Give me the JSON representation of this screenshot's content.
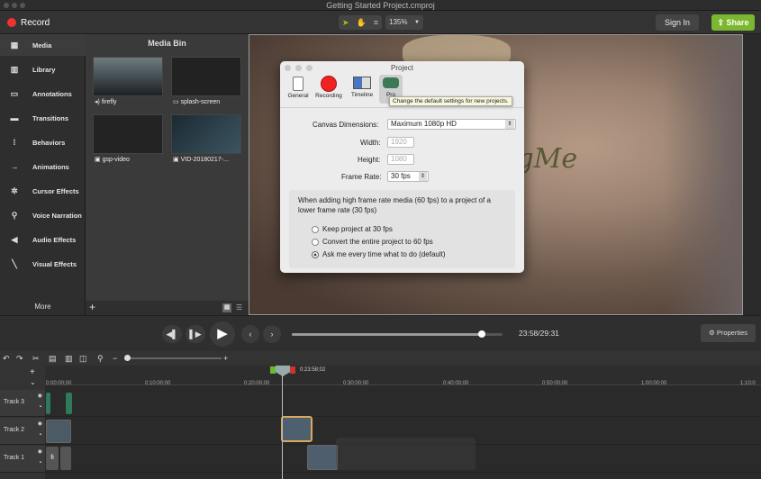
{
  "window": {
    "title": "Getting Started Project.cmproj"
  },
  "toolbar": {
    "record_label": "Record",
    "zoom": "135%",
    "sign_in": "Sign In",
    "share": "Share"
  },
  "sidebar": {
    "items": [
      {
        "label": "Media",
        "icon": "film-icon"
      },
      {
        "label": "Library",
        "icon": "library-icon"
      },
      {
        "label": "Annotations",
        "icon": "annotation-icon"
      },
      {
        "label": "Transitions",
        "icon": "transition-icon"
      },
      {
        "label": "Behaviors",
        "icon": "behavior-icon"
      },
      {
        "label": "Animations",
        "icon": "animation-icon"
      },
      {
        "label": "Cursor Effects",
        "icon": "cursor-icon"
      },
      {
        "label": "Voice Narration",
        "icon": "microphone-icon"
      },
      {
        "label": "Audio Effects",
        "icon": "speaker-icon"
      },
      {
        "label": "Visual Effects",
        "icon": "wand-icon"
      }
    ],
    "more": "More"
  },
  "media_bin": {
    "title": "Media Bin",
    "items": [
      {
        "label": "firefly"
      },
      {
        "label": "splash-screen"
      },
      {
        "label": "gsp-video"
      },
      {
        "label": "VID-20180217-..."
      }
    ],
    "add": "+"
  },
  "dialog": {
    "title": "Project",
    "tabs": [
      "General",
      "Recording",
      "Timeline",
      "Pro"
    ],
    "tooltip": "Change the default settings for new projects.",
    "canvas_label": "Canvas Dimensions:",
    "canvas_value": "Maximum 1080p HD",
    "width_label": "Width:",
    "width_value": "1920",
    "height_label": "Height:",
    "height_value": "1080",
    "framerate_label": "Frame Rate:",
    "framerate_value": "30 fps",
    "note": "When adding high frame rate media (60 fps) to a project of a lower frame rate (30 fps)",
    "options": [
      "Keep project at 30 fps",
      "Convert the entire project to 60 fps",
      "Ask me every time what to do (default)"
    ],
    "selected_option": 2
  },
  "watermark": "RuyaAgMe",
  "playback": {
    "time": "23:58/29:31",
    "progress": 0.9,
    "properties": "Properties"
  },
  "timeline": {
    "playhead_time": "0:23:58;02",
    "ticks": [
      "0:00:00;00",
      "0:10:00;00",
      "0:20:00;00",
      "0:30:00;00",
      "0:40:00;00",
      "0:50:00;00",
      "1:00:00;00",
      "1:10:0"
    ],
    "tracks": [
      "Track 3",
      "Track 2",
      "Track 1"
    ],
    "clip_label": "fi"
  }
}
